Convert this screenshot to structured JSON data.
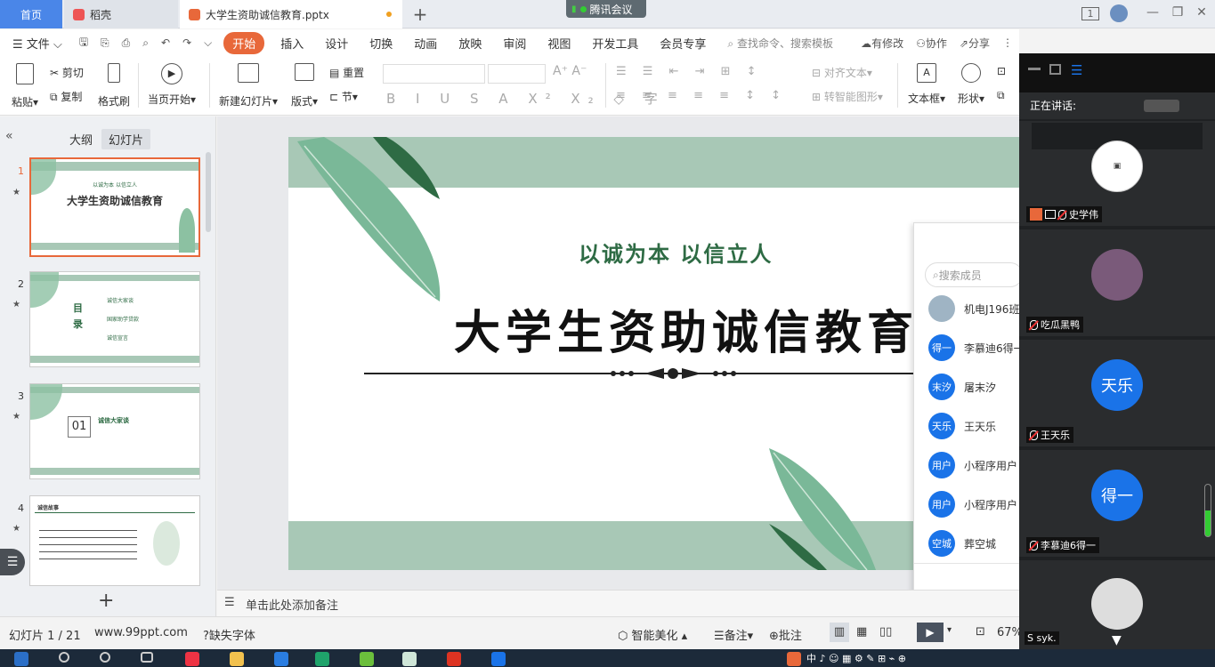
{
  "tabs": {
    "home": "首页",
    "daoke": "稻壳",
    "file": "大学生资助诚信教育.pptx"
  },
  "meeting_badge": "腾讯会议",
  "menu": {
    "file": "文件",
    "items": [
      "开始",
      "插入",
      "设计",
      "切换",
      "动画",
      "放映",
      "审阅",
      "视图",
      "开发工具",
      "会员专享"
    ],
    "search": "查找命令、搜索模板",
    "right": [
      "有修改",
      "协作",
      "分享"
    ]
  },
  "toolbar": {
    "paste": "粘贴",
    "cut": "剪切",
    "copy": "复制",
    "format_painter": "格式刷",
    "play_from_current": "当页开始",
    "new_slide": "新建幻灯片",
    "layout": "版式",
    "reset": "重置",
    "section": "节",
    "align_text": "对齐文本",
    "smart_graphic": "转智能图形",
    "textbox": "文本框",
    "shape": "形状"
  },
  "left_panel": {
    "tab_outline": "大纲",
    "tab_slides": "幻灯片",
    "slides": [
      {
        "num": "1",
        "title": "大学生资助诚信教育",
        "subtitle": "以诚为本 以信立人"
      },
      {
        "num": "2",
        "title": "目录",
        "items": [
          "诚信大家谈",
          "国家助学贷款",
          "诚信宣言"
        ]
      },
      {
        "num": "3",
        "title": "诚信大家谈",
        "badge": "01"
      },
      {
        "num": "4",
        "title": "诚信故事"
      }
    ]
  },
  "slide": {
    "subtitle": "以诚为本  以信立人",
    "title": "大学生资助诚信教育"
  },
  "notes_placeholder": "单击此处添加备注",
  "members_popup": {
    "search_placeholder": "搜索成员",
    "members": [
      {
        "avatar": "",
        "name": "机电J196班"
      },
      {
        "avatar": "得一",
        "name": "李慕迪6得一"
      },
      {
        "avatar": "末汐",
        "name": "屠末汐"
      },
      {
        "avatar": "天乐",
        "name": "王天乐"
      },
      {
        "avatar": "用户",
        "name": "小程序用户"
      },
      {
        "avatar": "用户",
        "name": "小程序用户"
      },
      {
        "avatar": "空城",
        "name": "葬空城"
      }
    ]
  },
  "status": {
    "slide_counter": "幻灯片 1 / 21",
    "website": "www.99ppt.com",
    "missing_font": "缺失字体",
    "smart_beautify": "智能美化",
    "notes": "备注",
    "comments": "批注",
    "zoom": "67%"
  },
  "meeting_panel": {
    "speaking_label": "正在讲话:",
    "participants": [
      {
        "name": "史学伟",
        "avatar_text": ""
      },
      {
        "name": "吃瓜黑鸭",
        "avatar_text": ""
      },
      {
        "name": "王天乐",
        "avatar_text": "天乐"
      },
      {
        "name": "李慕迪6得一",
        "avatar_text": "得一"
      },
      {
        "name": "",
        "avatar_text": ""
      }
    ],
    "bottom_label": "S syk."
  },
  "colors": {
    "accent": "#e8683a",
    "blue": "#1a73e8",
    "leaf": "#7ab898",
    "band": "#a8c8b6",
    "dark_green": "#2e6b44"
  }
}
